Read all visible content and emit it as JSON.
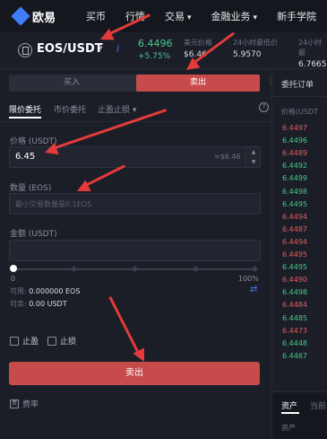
{
  "nav": {
    "logo_text": "欧易",
    "items": [
      "买币",
      "行情",
      "交易",
      "金融业务",
      "新手学院"
    ]
  },
  "ticker": {
    "pair": "EOS/USDT",
    "last_price": "6.4496",
    "change": "+5.75%",
    "stats": [
      {
        "label": "美元价格",
        "value": "$6.46"
      },
      {
        "label": "24小时最低价",
        "value": "5.9570"
      },
      {
        "label": "24小时最",
        "value": "6.7665"
      }
    ]
  },
  "trade": {
    "tab_buy": "买入",
    "tab_sell": "卖出",
    "order_types": [
      "限价委托",
      "市价委托",
      "止盈止损"
    ],
    "price_label": "价格 (USDT)",
    "price_value": "6.45",
    "price_hint": "≈$6.46",
    "amount_label": "数量 (EOS)",
    "amount_placeholder": "最小交易数量是0.1EOS",
    "total_label": "金额 (USDT)",
    "slider_min": "0",
    "slider_max": "100%",
    "slider_value": 0,
    "available_label": "可用:",
    "available_value": "0.000000 EOS",
    "sellable_label": "可卖:",
    "sellable_value": "0.00 USDT",
    "take_profit": "止盈",
    "stop_loss": "止损",
    "sell_button": "卖出",
    "fee_label": "费率"
  },
  "orderbook": {
    "title": "委托订单",
    "header": "价格(USDT",
    "asks": [
      "6.4497",
      "6.4496",
      "6.4489",
      "6.4494",
      "6.4487",
      "6.4494",
      "6.4495",
      "6.4490",
      "6.4484",
      "6.4473"
    ],
    "bids": [
      "6.4496",
      "6.4492",
      "6.4499",
      "6.4498",
      "6.4495",
      "6.4495",
      "6.4498",
      "6.4485",
      "6.4448",
      "6.4467"
    ],
    "rows": [
      {
        "p": "6.4497",
        "side": "red"
      },
      {
        "p": "6.4496",
        "side": "green"
      },
      {
        "p": "6.4489",
        "side": "red"
      },
      {
        "p": "6.4492",
        "side": "green"
      },
      {
        "p": "6.4499",
        "side": "green"
      },
      {
        "p": "6.4498",
        "side": "green"
      },
      {
        "p": "6.4495",
        "side": "green"
      },
      {
        "p": "6.4494",
        "side": "red"
      },
      {
        "p": "6.4487",
        "side": "red"
      },
      {
        "p": "6.4494",
        "side": "red"
      },
      {
        "p": "6.4495",
        "side": "red"
      },
      {
        "p": "6.4495",
        "side": "green"
      },
      {
        "p": "6.4490",
        "side": "red"
      },
      {
        "p": "6.4498",
        "side": "green"
      },
      {
        "p": "6.4484",
        "side": "red"
      },
      {
        "p": "6.4485",
        "side": "green"
      },
      {
        "p": "6.4473",
        "side": "red"
      },
      {
        "p": "6.4448",
        "side": "green"
      },
      {
        "p": "6.4467",
        "side": "green"
      }
    ],
    "bottom_tab_active": "资产",
    "bottom_tab_inactive": "当前",
    "bottom_sub": "资产"
  },
  "colors": {
    "accent_red": "#c74b4b",
    "ask_red": "#e85b5b",
    "bid_green": "#49c98a",
    "brand_blue": "#3f7ef6",
    "annotation_red": "#e33b3b"
  }
}
